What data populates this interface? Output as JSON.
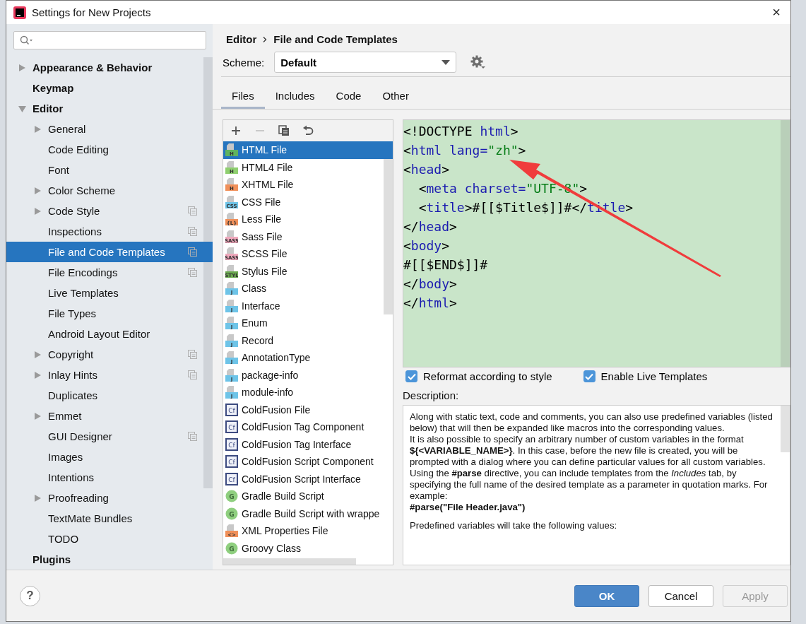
{
  "window": {
    "title": "Settings for New Projects",
    "close": "×"
  },
  "sidebar": {
    "items": [
      {
        "label": "Appearance & Behavior",
        "kind": "collapsed",
        "scope": false,
        "selected": false
      },
      {
        "label": "Keymap",
        "kind": "leaf",
        "scope": false,
        "selected": false
      },
      {
        "label": "Editor",
        "kind": "expanded",
        "scope": false,
        "selected": false,
        "children": [
          {
            "label": "General",
            "kind": "collapsed",
            "scope": false,
            "selected": false
          },
          {
            "label": "Code Editing",
            "kind": "leaf",
            "scope": false,
            "selected": false
          },
          {
            "label": "Font",
            "kind": "leaf",
            "scope": false,
            "selected": false
          },
          {
            "label": "Color Scheme",
            "kind": "collapsed",
            "scope": false,
            "selected": false
          },
          {
            "label": "Code Style",
            "kind": "collapsed",
            "scope": true,
            "selected": false
          },
          {
            "label": "Inspections",
            "kind": "leaf",
            "scope": true,
            "selected": false
          },
          {
            "label": "File and Code Templates",
            "kind": "leaf",
            "scope": true,
            "selected": true
          },
          {
            "label": "File Encodings",
            "kind": "leaf",
            "scope": true,
            "selected": false
          },
          {
            "label": "Live Templates",
            "kind": "leaf",
            "scope": false,
            "selected": false
          },
          {
            "label": "File Types",
            "kind": "leaf",
            "scope": false,
            "selected": false
          },
          {
            "label": "Android Layout Editor",
            "kind": "leaf",
            "scope": false,
            "selected": false
          },
          {
            "label": "Copyright",
            "kind": "collapsed",
            "scope": true,
            "selected": false
          },
          {
            "label": "Inlay Hints",
            "kind": "collapsed",
            "scope": true,
            "selected": false
          },
          {
            "label": "Duplicates",
            "kind": "leaf",
            "scope": false,
            "selected": false
          },
          {
            "label": "Emmet",
            "kind": "collapsed",
            "scope": false,
            "selected": false
          },
          {
            "label": "GUI Designer",
            "kind": "leaf",
            "scope": true,
            "selected": false
          },
          {
            "label": "Images",
            "kind": "leaf",
            "scope": false,
            "selected": false
          },
          {
            "label": "Intentions",
            "kind": "leaf",
            "scope": false,
            "selected": false
          },
          {
            "label": "Proofreading",
            "kind": "collapsed",
            "scope": false,
            "selected": false
          },
          {
            "label": "TextMate Bundles",
            "kind": "leaf",
            "scope": false,
            "selected": false
          },
          {
            "label": "TODO",
            "kind": "leaf",
            "scope": false,
            "selected": false
          }
        ]
      },
      {
        "label": "Plugins",
        "kind": "leaf",
        "scope": false,
        "selected": false
      }
    ]
  },
  "breadcrumb": [
    "Editor",
    "File and Code Templates"
  ],
  "scheme": {
    "label": "Scheme:",
    "value": "Default"
  },
  "tabs": [
    {
      "label": "Files",
      "selected": true
    },
    {
      "label": "Includes",
      "selected": false
    },
    {
      "label": "Code",
      "selected": false
    },
    {
      "label": "Other",
      "selected": false
    }
  ],
  "templates": [
    {
      "name": "HTML File",
      "kind": "file",
      "badge": "H",
      "color": "#5fb35f",
      "selected": true
    },
    {
      "name": "HTML4 File",
      "kind": "file",
      "badge": "H",
      "color": "#8fcf6f",
      "selected": false
    },
    {
      "name": "XHTML File",
      "kind": "file",
      "badge": "H",
      "color": "#f0905a",
      "selected": false
    },
    {
      "name": "CSS File",
      "kind": "file",
      "badge": "CSS",
      "color": "#6ec4e8",
      "selected": false
    },
    {
      "name": "Less File",
      "kind": "file",
      "badge": "{L}",
      "color": "#f0905a",
      "selected": false
    },
    {
      "name": "Sass File",
      "kind": "file",
      "badge": "SASS",
      "color": "#f0a8bc",
      "selected": false
    },
    {
      "name": "SCSS File",
      "kind": "file",
      "badge": "SASS",
      "color": "#f0a8bc",
      "selected": false
    },
    {
      "name": "Stylus File",
      "kind": "file",
      "badge": "STYL",
      "color": "#6aa84f",
      "selected": false
    },
    {
      "name": "Class",
      "kind": "file",
      "badge": "J",
      "color": "#6ec4e8",
      "selected": false
    },
    {
      "name": "Interface",
      "kind": "file",
      "badge": "J",
      "color": "#6ec4e8",
      "selected": false
    },
    {
      "name": "Enum",
      "kind": "file",
      "badge": "J",
      "color": "#6ec4e8",
      "selected": false
    },
    {
      "name": "Record",
      "kind": "file",
      "badge": "J",
      "color": "#6ec4e8",
      "selected": false
    },
    {
      "name": "AnnotationType",
      "kind": "file",
      "badge": "J",
      "color": "#6ec4e8",
      "selected": false
    },
    {
      "name": "package-info",
      "kind": "file",
      "badge": "J",
      "color": "#6ec4e8",
      "selected": false
    },
    {
      "name": "module-info",
      "kind": "file",
      "badge": "J",
      "color": "#6ec4e8",
      "selected": false
    },
    {
      "name": "ColdFusion File",
      "kind": "square",
      "badge": "Cf",
      "color": "#3d4b80",
      "selected": false
    },
    {
      "name": "ColdFusion Tag Component",
      "kind": "square",
      "badge": "Cf",
      "color": "#3d4b80",
      "selected": false
    },
    {
      "name": "ColdFusion Tag Interface",
      "kind": "square",
      "badge": "Cf",
      "color": "#3d4b80",
      "selected": false
    },
    {
      "name": "ColdFusion Script Component",
      "kind": "square",
      "badge": "Cf",
      "color": "#3d4b80",
      "selected": false
    },
    {
      "name": "ColdFusion Script Interface",
      "kind": "square",
      "badge": "Cf",
      "color": "#3d4b80",
      "selected": false
    },
    {
      "name": "Gradle Build Script",
      "kind": "circle",
      "badge": "G",
      "color": "#8fcf7f",
      "selected": false
    },
    {
      "name": "Gradle Build Script with wrappe",
      "kind": "circle",
      "badge": "G",
      "color": "#8fcf7f",
      "selected": false
    },
    {
      "name": "XML Properties File",
      "kind": "file",
      "badge": "<>",
      "color": "#f0905a",
      "selected": false
    },
    {
      "name": "Groovy Class",
      "kind": "circle",
      "badge": "G",
      "color": "#8fcf7f",
      "selected": false
    }
  ],
  "code": [
    [
      {
        "kind": "plain",
        "text": "<!DOCTYPE "
      },
      {
        "kind": "tag",
        "text": "html"
      },
      {
        "kind": "plain",
        "text": ">"
      }
    ],
    [
      {
        "kind": "plain",
        "text": "<"
      },
      {
        "kind": "tag",
        "text": "html lang="
      },
      {
        "kind": "string",
        "text": "\"zh\""
      },
      {
        "kind": "plain",
        "text": ">"
      }
    ],
    [
      {
        "kind": "plain",
        "text": "<"
      },
      {
        "kind": "tag",
        "text": "head"
      },
      {
        "kind": "plain",
        "text": ">"
      }
    ],
    [
      {
        "kind": "plain",
        "text": "  <"
      },
      {
        "kind": "tag",
        "text": "meta charset="
      },
      {
        "kind": "string",
        "text": "\"UTF-8\""
      },
      {
        "kind": "plain",
        "text": ">"
      }
    ],
    [
      {
        "kind": "plain",
        "text": "  <"
      },
      {
        "kind": "tag",
        "text": "title"
      },
      {
        "kind": "plain",
        "text": ">#[[$Title$]]#</"
      },
      {
        "kind": "tag",
        "text": "title"
      },
      {
        "kind": "plain",
        "text": ">"
      }
    ],
    [
      {
        "kind": "plain",
        "text": "</"
      },
      {
        "kind": "tag",
        "text": "head"
      },
      {
        "kind": "plain",
        "text": ">"
      }
    ],
    [
      {
        "kind": "plain",
        "text": "<"
      },
      {
        "kind": "tag",
        "text": "body"
      },
      {
        "kind": "plain",
        "text": ">"
      }
    ],
    [
      {
        "kind": "plain",
        "text": "#[[$END$]]#"
      }
    ],
    [
      {
        "kind": "plain",
        "text": "</"
      },
      {
        "kind": "tag",
        "text": "body"
      },
      {
        "kind": "plain",
        "text": ">"
      }
    ],
    [
      {
        "kind": "plain",
        "text": "</"
      },
      {
        "kind": "tag",
        "text": "html"
      },
      {
        "kind": "plain",
        "text": ">"
      }
    ]
  ],
  "options": [
    {
      "label": "Reformat according to style",
      "checked": true
    },
    {
      "label": "Enable Live Templates",
      "checked": true
    }
  ],
  "description": {
    "label": "Description:",
    "paragraphs": [
      {
        "kind": "text",
        "text": "Along with static text, code and comments, you can also use predefined variables (listed below) that will then be expanded like macros into the corresponding values."
      },
      {
        "kind": "text",
        "text": "It is also possible to specify an arbitrary number of custom variables in the format **${<VARIABLE_NAME>}**. In this case, before the new file is created, you will be prompted with a dialog where you can define particular values for all custom variables."
      },
      {
        "kind": "text",
        "text": "Using the **#parse** directive, you can include templates from the *Includes* tab, by specifying the full name of the desired template as a parameter in quotation marks. For example:"
      },
      {
        "kind": "code",
        "text": "#parse(\"File Header.java\")"
      },
      {
        "kind": "gap",
        "text": "Predefined variables will take the following values:"
      }
    ]
  },
  "footer": {
    "help": "?",
    "buttons": [
      {
        "label": "OK",
        "kind": "primary",
        "disabled": false
      },
      {
        "label": "Cancel",
        "kind": "normal",
        "disabled": false
      },
      {
        "label": "Apply",
        "kind": "normal",
        "disabled": true
      }
    ]
  }
}
